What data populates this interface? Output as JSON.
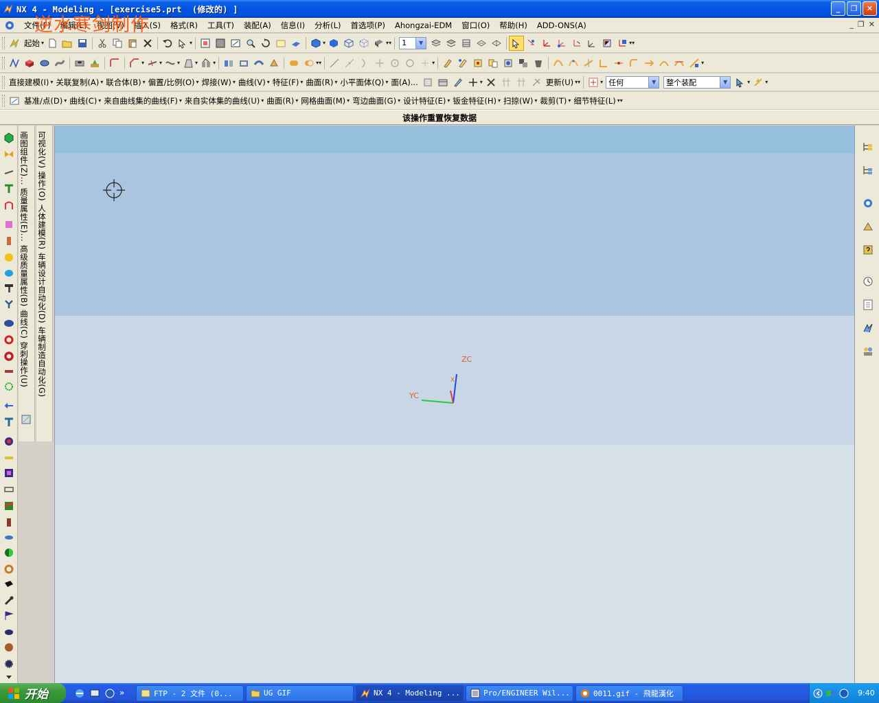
{
  "window": {
    "title": "NX 4 - Modeling - [exercise5.prt  (修改的) ]",
    "watermark": "逆水寒剑制作",
    "buttons": [
      "_",
      "❐",
      "✕"
    ]
  },
  "menubar": {
    "items": [
      "文件(F)",
      "编辑(E)",
      "视图(V)",
      "插入(S)",
      "格式(R)",
      "工具(T)",
      "装配(A)",
      "信息(I)",
      "分析(L)",
      "首选项(P)",
      "Ahongzai-EDM",
      "窗口(O)",
      "帮助(H)",
      "ADD-ONS(A)"
    ],
    "mdi_controls": [
      "_",
      "❐",
      "✕"
    ]
  },
  "toolbar1": {
    "start_label": "起始",
    "layer_value": "1"
  },
  "toolbar3": {
    "items": [
      "直接建模(I)",
      "关联复制(A)",
      "联合体(B)",
      "偏置/比例(O)",
      "焊接(W)",
      "曲线(V)",
      "特征(F)",
      "曲面(R)",
      "小平面体(Q)",
      "面(A)..."
    ],
    "update_label": "更新(U)",
    "filter_value": "任何",
    "scope_value": "整个装配"
  },
  "toolbar4": {
    "items": [
      "基准/点(D)",
      "曲线(C)",
      "来自曲线集的曲线(F)",
      "来自实体集的曲线(U)",
      "曲面(R)",
      "网格曲面(M)",
      "弯边曲面(G)",
      "设计特征(E)",
      "钣金特征(H)",
      "扫掠(W)",
      "裁剪(T)",
      "细节特征(L)"
    ]
  },
  "cue_line": "该操作重置恢复数据",
  "vertical_toolbars": {
    "col1": "画图组件(Z)...  质量属性(E)...  高级质量属性(B)  曲线(C)  穿刺操作(U)",
    "col2": "可视化(V)  操作(O)  人体建模(R)  车辆设计自动化(D)  车辆制造自动化(G)"
  },
  "triad": {
    "zc": "ZC",
    "yc": "YC",
    "xc": "X"
  },
  "taskbar": {
    "start_label": "开始",
    "tasks": [
      {
        "label": "FTP - 2 文件  (0...",
        "active": false
      },
      {
        "label": "UG GIF",
        "active": false
      },
      {
        "label": "NX 4 - Modeling ...",
        "active": true
      },
      {
        "label": "Pro/ENGINEER Wil...",
        "active": false
      },
      {
        "label": "0011.gif - 飛龍漢化",
        "active": false
      }
    ],
    "clock": "9:40"
  },
  "colors": {
    "title_bar": "#0054e3",
    "graphics_band_top": "#97c0df",
    "graphics_band_mid": "#abc5e0",
    "graphics_band_low": "#c9d6e5",
    "graphics_background": "#d7e1ea",
    "triad_label": "#e0612b"
  }
}
